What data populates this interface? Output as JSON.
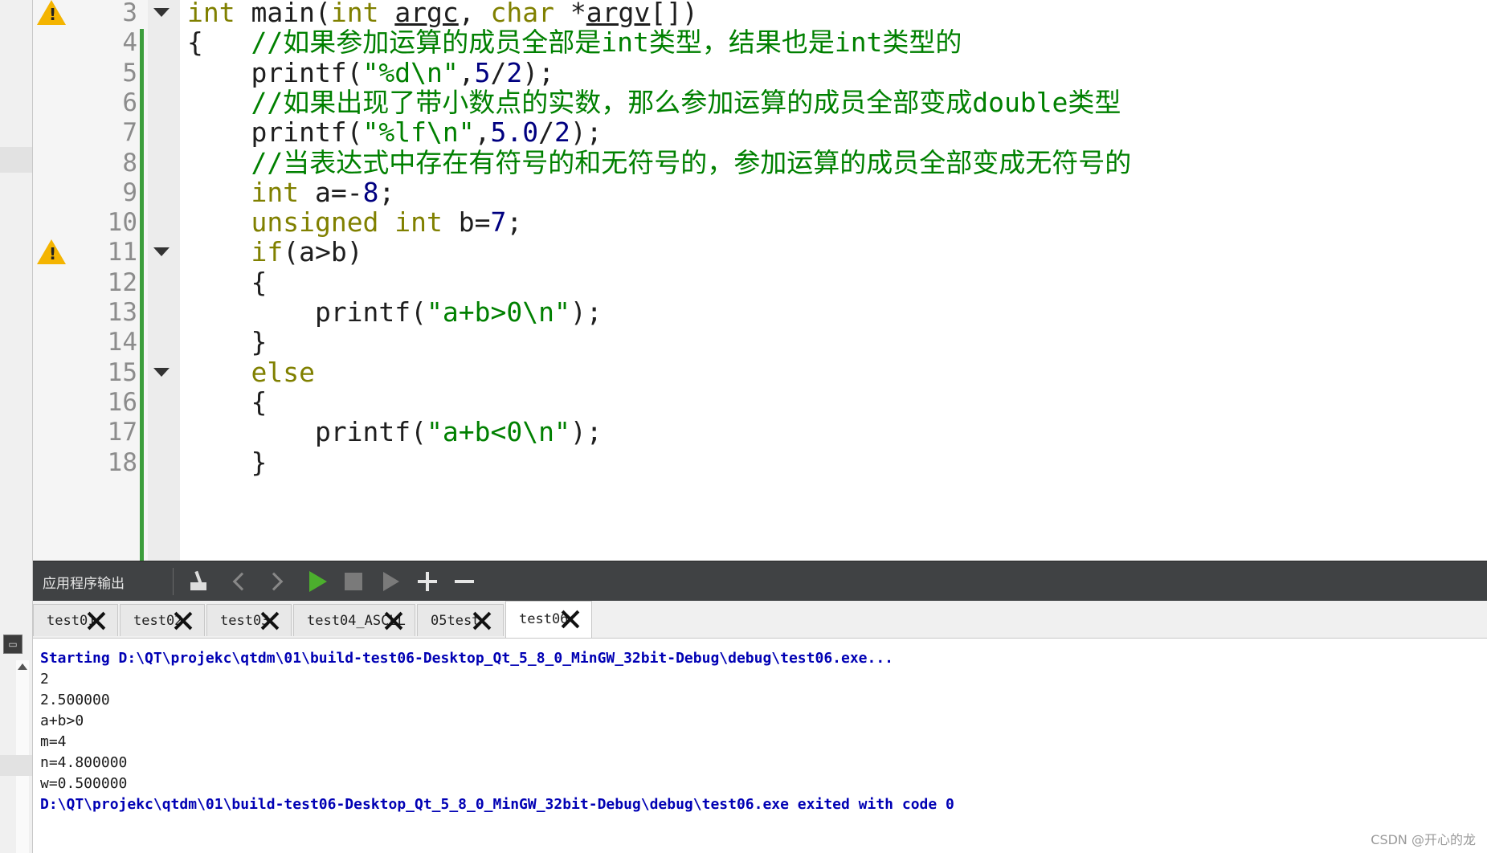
{
  "editor": {
    "lines": [
      {
        "num": "3",
        "warn": true,
        "fold": true,
        "parts": [
          [
            "kw",
            "int"
          ],
          [
            "t",
            " main("
          ],
          [
            "kw",
            "int"
          ],
          [
            "t",
            " "
          ],
          [
            "ul",
            "argc"
          ],
          [
            "t",
            ", "
          ],
          [
            "kw",
            "char"
          ],
          [
            "t",
            " *"
          ],
          [
            "ul",
            "argv"
          ],
          [
            "t",
            "[])"
          ]
        ]
      },
      {
        "num": "4",
        "warn": false,
        "fold": false,
        "parts": [
          [
            "t",
            "{   "
          ],
          [
            "cm",
            "//如果参加运算的成员全部是int类型，结果也是int类型的"
          ]
        ]
      },
      {
        "num": "5",
        "warn": false,
        "fold": false,
        "parts": [
          [
            "t",
            "    printf("
          ],
          [
            "st",
            "\"%d\\n\""
          ],
          [
            "t",
            ","
          ],
          [
            "nm",
            "5"
          ],
          [
            "t",
            "/"
          ],
          [
            "nm",
            "2"
          ],
          [
            "t",
            ");"
          ]
        ]
      },
      {
        "num": "6",
        "warn": false,
        "fold": false,
        "parts": [
          [
            "t",
            "    "
          ],
          [
            "cm",
            "//如果出现了带小数点的实数，那么参加运算的成员全部变成double类型"
          ]
        ]
      },
      {
        "num": "7",
        "warn": false,
        "fold": false,
        "parts": [
          [
            "t",
            "    printf("
          ],
          [
            "st",
            "\"%lf\\n\""
          ],
          [
            "t",
            ","
          ],
          [
            "nm",
            "5.0"
          ],
          [
            "t",
            "/"
          ],
          [
            "nm",
            "2"
          ],
          [
            "t",
            ");"
          ]
        ]
      },
      {
        "num": "8",
        "warn": false,
        "fold": false,
        "parts": [
          [
            "t",
            "    "
          ],
          [
            "cm",
            "//当表达式中存在有符号的和无符号的，参加运算的成员全部变成无符号的"
          ]
        ]
      },
      {
        "num": "9",
        "warn": false,
        "fold": false,
        "parts": [
          [
            "t",
            "    "
          ],
          [
            "kw",
            "int"
          ],
          [
            "t",
            " a=-"
          ],
          [
            "nm",
            "8"
          ],
          [
            "t",
            ";"
          ]
        ]
      },
      {
        "num": "10",
        "warn": false,
        "fold": false,
        "parts": [
          [
            "t",
            "    "
          ],
          [
            "kw",
            "unsigned int"
          ],
          [
            "t",
            " b="
          ],
          [
            "nm",
            "7"
          ],
          [
            "t",
            ";"
          ]
        ]
      },
      {
        "num": "11",
        "warn": true,
        "fold": true,
        "parts": [
          [
            "t",
            "    "
          ],
          [
            "kw",
            "if"
          ],
          [
            "t",
            "(a>b)"
          ]
        ]
      },
      {
        "num": "12",
        "warn": false,
        "fold": false,
        "parts": [
          [
            "t",
            "    {"
          ]
        ]
      },
      {
        "num": "13",
        "warn": false,
        "fold": false,
        "parts": [
          [
            "t",
            "        printf("
          ],
          [
            "st",
            "\"a+b>0\\n\""
          ],
          [
            "t",
            ");"
          ]
        ]
      },
      {
        "num": "14",
        "warn": false,
        "fold": false,
        "parts": [
          [
            "t",
            "    }"
          ]
        ]
      },
      {
        "num": "15",
        "warn": false,
        "fold": true,
        "parts": [
          [
            "t",
            "    "
          ],
          [
            "kw",
            "else"
          ]
        ]
      },
      {
        "num": "16",
        "warn": false,
        "fold": false,
        "parts": [
          [
            "t",
            "    {"
          ]
        ]
      },
      {
        "num": "17",
        "warn": false,
        "fold": false,
        "parts": [
          [
            "t",
            "        printf("
          ],
          [
            "st",
            "\"a+b<0\\n\""
          ],
          [
            "t",
            ");"
          ]
        ]
      },
      {
        "num": "18",
        "warn": false,
        "fold": false,
        "parts": [
          [
            "t",
            "    }"
          ]
        ]
      }
    ]
  },
  "output_panel": {
    "title": "应用程序输出",
    "toolbar_icons": [
      "broom-clear-icon",
      "chevron-left-icon",
      "chevron-right-icon",
      "run-icon",
      "stop-icon",
      "debug-run-icon",
      "plus-icon",
      "minus-icon"
    ]
  },
  "tabs": [
    {
      "label": "test01",
      "active": false
    },
    {
      "label": "test02",
      "active": false
    },
    {
      "label": "test03",
      "active": false
    },
    {
      "label": "test04_ASCLL",
      "active": false
    },
    {
      "label": "05test",
      "active": false
    },
    {
      "label": "test06",
      "active": true
    }
  ],
  "console": {
    "lines": [
      {
        "text": "Starting D:\\QT\\projekc\\qtdm\\01\\build-test06-Desktop_Qt_5_8_0_MinGW_32bit-Debug\\debug\\test06.exe...",
        "style": "blue"
      },
      {
        "text": "2",
        "style": "normal"
      },
      {
        "text": "2.500000",
        "style": "normal"
      },
      {
        "text": "a+b>0",
        "style": "normal"
      },
      {
        "text": "m=4",
        "style": "normal"
      },
      {
        "text": "n=4.800000",
        "style": "normal"
      },
      {
        "text": "w=0.500000",
        "style": "normal"
      },
      {
        "text": "D:\\QT\\projekc\\qtdm\\01\\build-test06-Desktop_Qt_5_8_0_MinGW_32bit-Debug\\debug\\test06.exe exited with code 0",
        "style": "blue"
      }
    ]
  },
  "watermark": "CSDN @开心的龙",
  "colors": {
    "keyword": "#808000",
    "comment": "#008000",
    "number": "#000080",
    "console_info": "#0000b4",
    "change_bar": "#3c9e3c",
    "toolbar_bg": "#404244"
  }
}
